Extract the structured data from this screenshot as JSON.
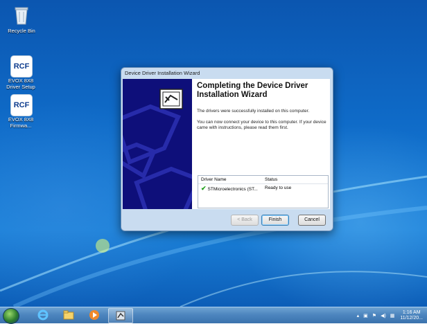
{
  "desktop": {
    "icons": [
      {
        "label": "Recycle Bin",
        "icon": "recycle-bin-icon"
      },
      {
        "label": "EVOX 8X8\nDriver Setup",
        "badge": "RCF",
        "icon": "rcf-icon"
      },
      {
        "label": "EVOX 8X8\nFirmwa...",
        "badge": "RCF",
        "icon": "rcf-icon"
      }
    ]
  },
  "dialog": {
    "title": "Device Driver Installation Wizard",
    "heading": "Completing the Device Driver Installation Wizard",
    "para1": "The drivers were successfully installed on this computer.",
    "para2": "You can now connect your device to this computer. If your device came with instructions, please read them first.",
    "table": {
      "headers": [
        "Driver Name",
        "Status"
      ],
      "rows": [
        {
          "name": "STMicroelectronics (ST...",
          "status": "Ready to use"
        }
      ]
    },
    "buttons": {
      "back": "< Back",
      "finish": "Finish",
      "cancel": "Cancel"
    }
  },
  "taskbar": {
    "apps": [
      "ie-icon",
      "explorer-icon",
      "media-player-icon",
      "wizard-icon"
    ],
    "clock": {
      "time": "1:16 AM",
      "date": "11/12/20..."
    }
  }
}
